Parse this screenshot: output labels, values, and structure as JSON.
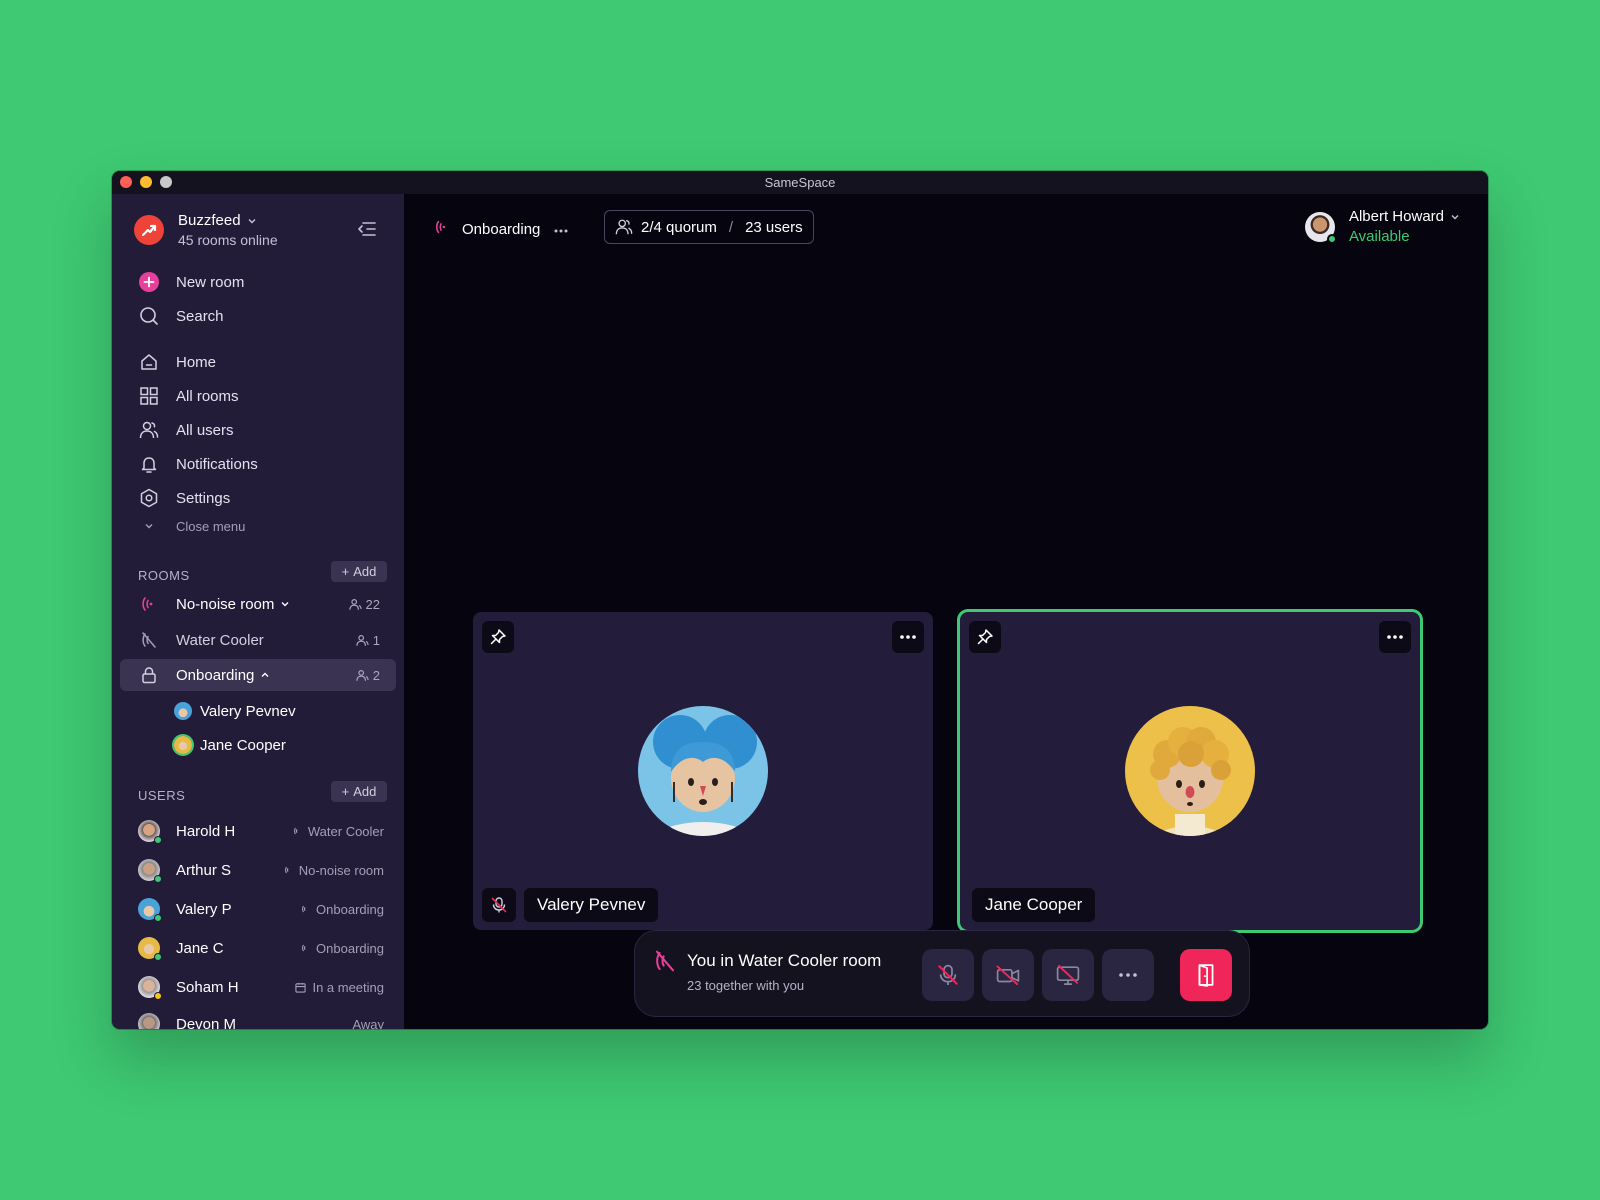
{
  "window": {
    "title": "SameSpace"
  },
  "workspace": {
    "name": "Buzzfeed",
    "subtitle": "45 rooms online"
  },
  "nav": {
    "new_room": "New room",
    "search": "Search",
    "home": "Home",
    "all_rooms": "All rooms",
    "all_users": "All users",
    "notifications": "Notifications",
    "settings": "Settings",
    "close_menu": "Close menu"
  },
  "rooms": {
    "header": "ROOMS",
    "add_label": "Add",
    "items": [
      {
        "name": "No-noise room",
        "count": "22"
      },
      {
        "name": "Water Cooler",
        "count": "1"
      },
      {
        "name": "Onboarding",
        "count": "2"
      }
    ],
    "onboarding_members": [
      "Valery Pevnev",
      "Jane Cooper"
    ]
  },
  "users": {
    "header": "USERS",
    "add_label": "Add",
    "items": [
      {
        "name": "Harold H",
        "location": "Water Cooler",
        "status_color": "#3ec972"
      },
      {
        "name": "Arthur S",
        "location": "No-noise room",
        "status_color": "#3ec972"
      },
      {
        "name": "Valery P",
        "location": "Onboarding",
        "status_color": "#3ec972"
      },
      {
        "name": "Jane C",
        "location": "Onboarding",
        "status_color": "#3ec972"
      },
      {
        "name": "Soham H",
        "location": "In a meeting",
        "status_color": "#f5c518"
      },
      {
        "name": "Devon M",
        "location": "Away",
        "status_color": "#8c87a0"
      }
    ]
  },
  "header": {
    "room_name": "Onboarding",
    "quorum": "2/4 quorum",
    "separator": "/",
    "users_count": "23 users"
  },
  "me": {
    "name": "Albert Howard",
    "status": "Available"
  },
  "tiles": [
    {
      "name": "Valery Pevnev",
      "muted": true,
      "speaking": false
    },
    {
      "name": "Jane Cooper",
      "muted": false,
      "speaking": true
    }
  ],
  "call_bar": {
    "title": "You in Water Cooler room",
    "subtitle": "23 together with you"
  },
  "colors": {
    "accent_green": "#3ec972",
    "leave_red": "#f0265b",
    "room_pink": "#e8409a",
    "sidebar_bg": "#221c39",
    "main_bg": "#05040f"
  }
}
